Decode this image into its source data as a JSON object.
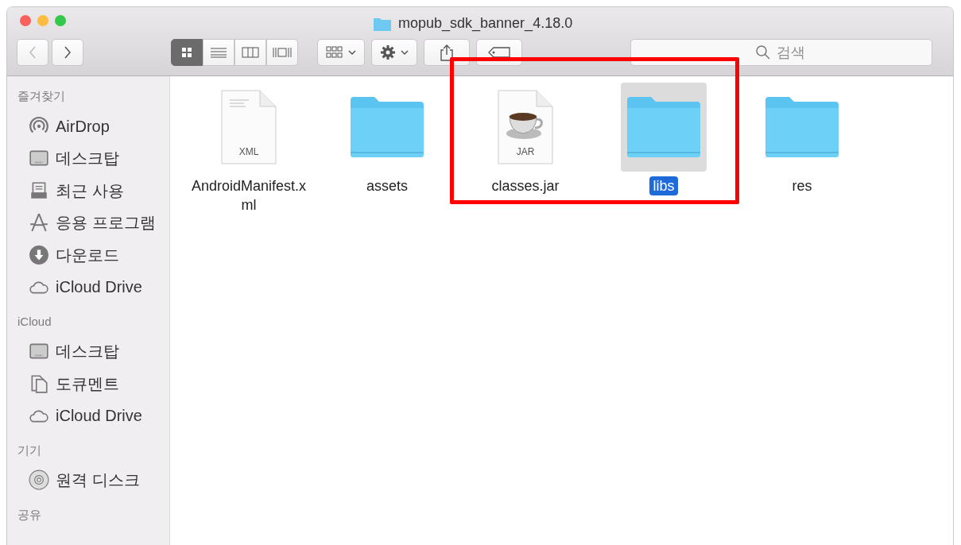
{
  "window": {
    "title": "mopub_sdk_banner_4.18.0"
  },
  "toolbar": {
    "search": {
      "placeholder": "검색"
    }
  },
  "sidebar": [
    {
      "heading": "즐겨찾기",
      "items": [
        {
          "label": "AirDrop",
          "kind": "airdrop"
        },
        {
          "label": "데스크탑",
          "kind": "desktop"
        },
        {
          "label": "최근 사용",
          "kind": "recent"
        },
        {
          "label": "응용 프로그램",
          "kind": "apps"
        },
        {
          "label": "다운로드",
          "kind": "download"
        },
        {
          "label": "iCloud Drive",
          "kind": "cloud"
        }
      ]
    },
    {
      "heading": "iCloud",
      "items": [
        {
          "label": "데스크탑",
          "kind": "desktop"
        },
        {
          "label": "도큐멘트",
          "kind": "documents"
        },
        {
          "label": "iCloud Drive",
          "kind": "cloud"
        }
      ]
    },
    {
      "heading": "기기",
      "items": [
        {
          "label": "원격 디스크",
          "kind": "disc"
        }
      ]
    },
    {
      "heading": "공유"
    }
  ],
  "files": [
    {
      "name": "AndroidManifest.x\nml",
      "kind": "document",
      "badge": "XML",
      "selected": false,
      "highlighted": false
    },
    {
      "name": "assets",
      "kind": "folder",
      "selected": false,
      "highlighted": false
    },
    {
      "name": "classes.jar",
      "kind": "jar",
      "badge": "JAR",
      "selected": false,
      "highlighted": true
    },
    {
      "name": "libs",
      "kind": "folder",
      "selected": true,
      "highlighted": true
    },
    {
      "name": "res",
      "kind": "folder",
      "selected": false,
      "highlighted": false
    }
  ]
}
